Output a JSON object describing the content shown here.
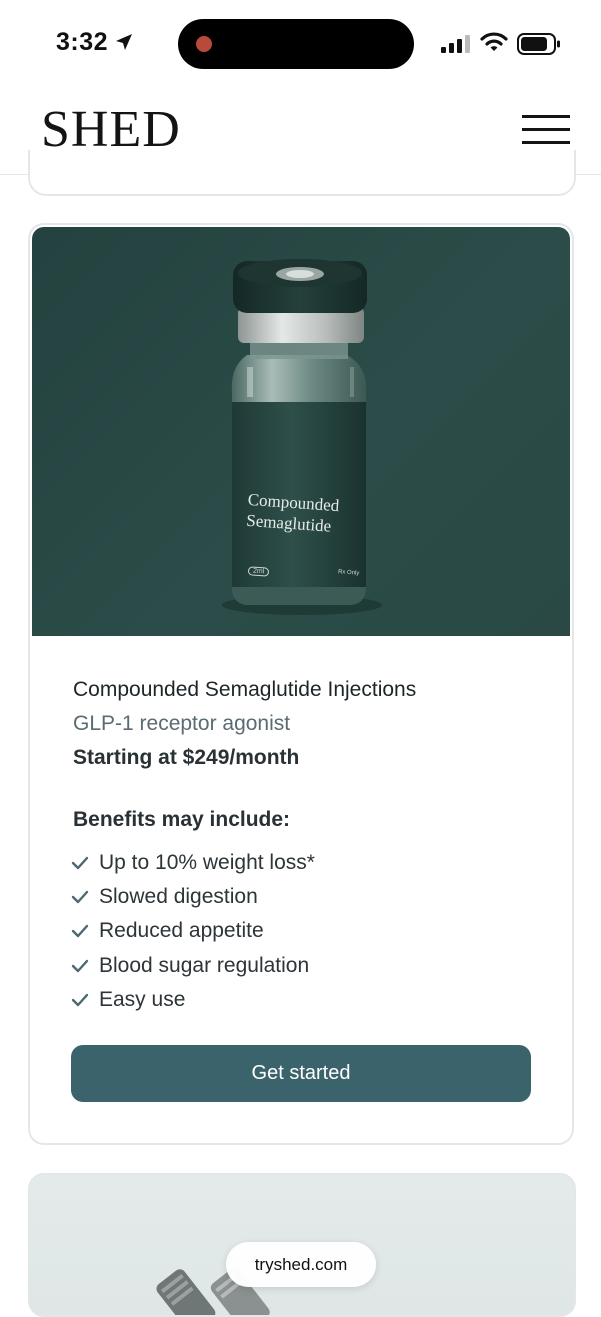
{
  "status_bar": {
    "time": "3:32"
  },
  "header": {
    "logo": "SHED"
  },
  "product": {
    "name": "Compounded Semaglutide Injections",
    "drug_class": "GLP-1 receptor agonist",
    "price": "Starting at $249/month",
    "image_label_line1": "Compounded",
    "image_label_line2": "Semaglutide",
    "image_volume": "2ml",
    "image_rx": "Rx Only",
    "benefits_title": "Benefits may include:",
    "benefits": [
      "Up to 10% weight loss*",
      "Slowed digestion",
      "Reduced appetite",
      "Blood sugar regulation",
      "Easy use"
    ],
    "cta_label": "Get started"
  },
  "browser": {
    "url": "tryshed.com"
  },
  "colors": {
    "brand_teal": "#3a636b",
    "image_bg": "#2b4c48",
    "check": "#4a6a70"
  }
}
